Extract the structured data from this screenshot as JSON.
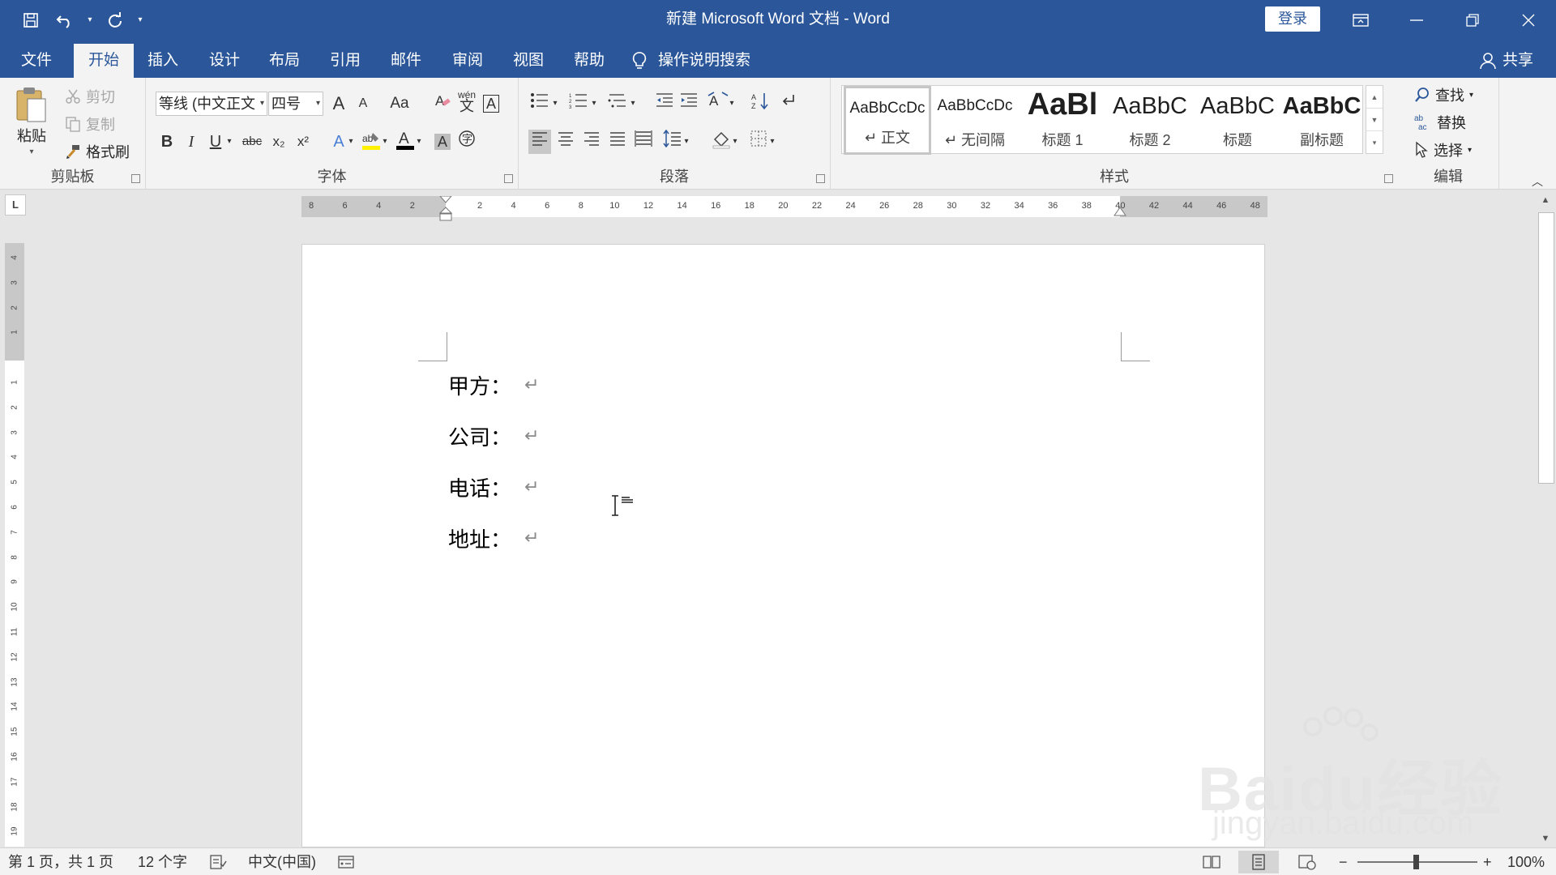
{
  "window": {
    "title": "新建 Microsoft Word 文档  -  Word",
    "login_label": "登录",
    "controls": [
      "ribbon-display",
      "minimize",
      "restore",
      "close"
    ]
  },
  "colors": {
    "title_bar": "#2b579a",
    "ribbon_bg": "#f3f3f3",
    "canvas_bg": "#e6e6e6"
  },
  "ribbon_tabs": [
    "文件",
    "开始",
    "插入",
    "设计",
    "布局",
    "引用",
    "邮件",
    "审阅",
    "视图",
    "帮助"
  ],
  "active_tab": "开始",
  "tell_me": "操作说明搜索",
  "share": "共享",
  "clipboard": {
    "paste": "粘贴",
    "cut": "剪切",
    "copy": "复制",
    "format_painter": "格式刷",
    "group_label": "剪贴板"
  },
  "font": {
    "font_name": "等线 (中文正文",
    "font_size": "四号",
    "group_label": "字体",
    "bold": "B",
    "italic": "I",
    "underline": "U",
    "strike": "abc",
    "subscript": "x₂",
    "superscript": "x²",
    "phonetic": "wén",
    "char_border": "A",
    "grow": "A",
    "shrink": "A",
    "change_case": "Aa"
  },
  "paragraph": {
    "group_label": "段落"
  },
  "styles": {
    "group_label": "样式",
    "items": [
      {
        "preview": "AaBbCcDc",
        "name": "正文"
      },
      {
        "preview": "AaBbCcDc",
        "name": "无间隔"
      },
      {
        "preview": "AaBl",
        "name": "标题 1"
      },
      {
        "preview": "AaBbC",
        "name": "标题 2"
      },
      {
        "preview": "AaBbC",
        "name": "标题"
      },
      {
        "preview": "AaBbC",
        "name": "副标题"
      }
    ]
  },
  "editing": {
    "find": "查找",
    "replace": "替换",
    "select": "选择",
    "group_label": "编辑"
  },
  "ruler": {
    "corner": "L",
    "h_ticks": [
      "8",
      "6",
      "4",
      "2",
      "",
      "2",
      "4",
      "6",
      "8",
      "10",
      "12",
      "14",
      "16",
      "18",
      "20",
      "22",
      "24",
      "26",
      "28",
      "30",
      "32",
      "34",
      "36",
      "38",
      "40",
      "42",
      "44",
      "46",
      "48"
    ],
    "v_ticks": [
      "4",
      "3",
      "2",
      "1",
      "",
      "1",
      "2",
      "3",
      "4",
      "5",
      "6",
      "7",
      "8",
      "9",
      "10",
      "11",
      "12",
      "13",
      "14",
      "15",
      "16",
      "17",
      "18",
      "19"
    ]
  },
  "document": {
    "lines": [
      "甲方：",
      "公司：",
      "电话：",
      "地址："
    ],
    "paragraph_mark": "↵"
  },
  "status": {
    "page": "第 1 页，共 1 页",
    "words": "12 个字",
    "language": "中文(中国)",
    "zoom": "100%",
    "zoom_level": 1.0
  },
  "watermark": {
    "text": "Baidu经验",
    "sub": "jingyan.baidu.com"
  }
}
